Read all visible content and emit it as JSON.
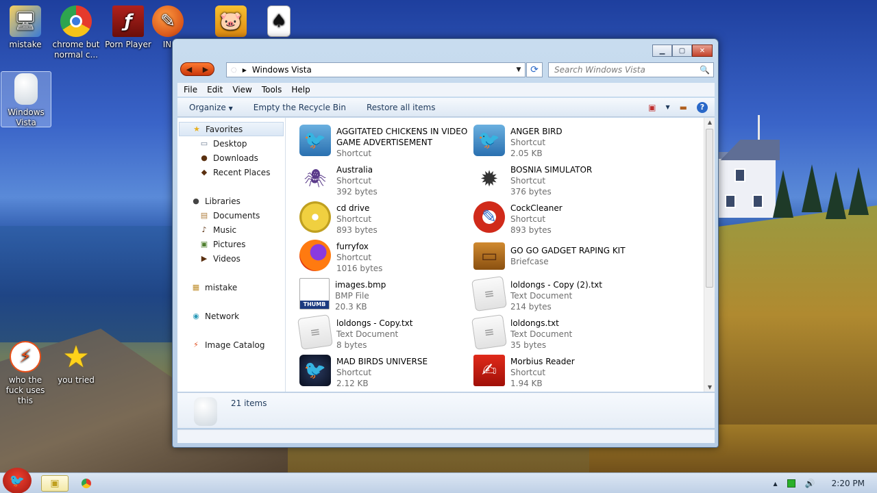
{
  "desktop": {
    "icons": [
      {
        "label": "mistake"
      },
      {
        "label": "chrome but normal c..."
      },
      {
        "label": "Porn Player"
      },
      {
        "label": "IN"
      },
      {
        "label": ""
      },
      {
        "label": ""
      },
      {
        "label": "Windows Vista"
      },
      {
        "label": "who the fuck uses this"
      },
      {
        "label": "you tried"
      }
    ]
  },
  "window": {
    "address": "Windows Vista",
    "search_placeholder": "Search Windows Vista",
    "menu": [
      "File",
      "Edit",
      "View",
      "Tools",
      "Help"
    ],
    "toolbar": [
      "Organize",
      "Empty the Recycle Bin",
      "Restore all items"
    ],
    "nav": {
      "favorites": "Favorites",
      "desktop": "Desktop",
      "downloads": "Downloads",
      "recent": "Recent Places",
      "libraries": "Libraries",
      "documents": "Documents",
      "music": "Music",
      "pictures": "Pictures",
      "videos": "Videos",
      "mistake": "mistake",
      "network": "Network",
      "catalog": "Image Catalog"
    },
    "files": [
      {
        "name": "AGGITATED CHICKENS IN VIDEO GAME ADVERTISEMENT",
        "type": "Shortcut",
        "size": ""
      },
      {
        "name": "ANGER BIRD",
        "type": "Shortcut",
        "size": "2.05 KB"
      },
      {
        "name": "Australia",
        "type": "Shortcut",
        "size": "392 bytes"
      },
      {
        "name": "BOSNIA SIMULATOR",
        "type": "Shortcut",
        "size": "376 bytes"
      },
      {
        "name": "cd drive",
        "type": "Shortcut",
        "size": "893 bytes"
      },
      {
        "name": "CockCleaner",
        "type": "Shortcut",
        "size": "893 bytes"
      },
      {
        "name": "furryfox",
        "type": "Shortcut",
        "size": "1016 bytes"
      },
      {
        "name": "GO GO GADGET RAPING KIT",
        "type": "Briefcase",
        "size": ""
      },
      {
        "name": "images.bmp",
        "type": "BMP File",
        "size": "20.3 KB"
      },
      {
        "name": "loldongs - Copy (2).txt",
        "type": "Text Document",
        "size": "214 bytes"
      },
      {
        "name": "loldongs - Copy.txt",
        "type": "Text Document",
        "size": "8 bytes"
      },
      {
        "name": "loldongs.txt",
        "type": "Text Document",
        "size": "35 bytes"
      },
      {
        "name": "MAD BIRDS UNIVERSE",
        "type": "Shortcut",
        "size": "2.12 KB"
      },
      {
        "name": "Morbius Reader",
        "type": "Shortcut",
        "size": "1.94 KB"
      }
    ],
    "details_count": "21 items"
  },
  "taskbar": {
    "clock": "2:20 PM"
  }
}
